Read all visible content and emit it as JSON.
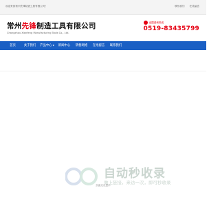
{
  "topbar": {
    "welcome": "欢迎来到常州先锋制造工具有限公司！",
    "links": [
      "联系我们",
      "在线留言"
    ]
  },
  "header": {
    "company_prefix": "常州",
    "company_highlight": "先锋",
    "company_suffix": "制造工具有限公司",
    "company_en": "Changzhou Xianfeng Manufacturing Tools Co., Ltd.",
    "phone_label": "全国咨询热线",
    "phone": "0519-83435799"
  },
  "nav": {
    "items": [
      "首页",
      "关于我们",
      "产品中心",
      "新闻中心",
      "销售网络",
      "在线留言",
      "联系我们"
    ],
    "dropdown_index": 2
  },
  "content": {
    "not_found": "页面无法显示"
  },
  "watermark": {
    "title": "自动秒收录",
    "subtitle": "做上链接，来访一次，即可秒收录"
  },
  "colors": {
    "brand_red": "#e60012",
    "nav_blue": "#1a5fc4"
  }
}
